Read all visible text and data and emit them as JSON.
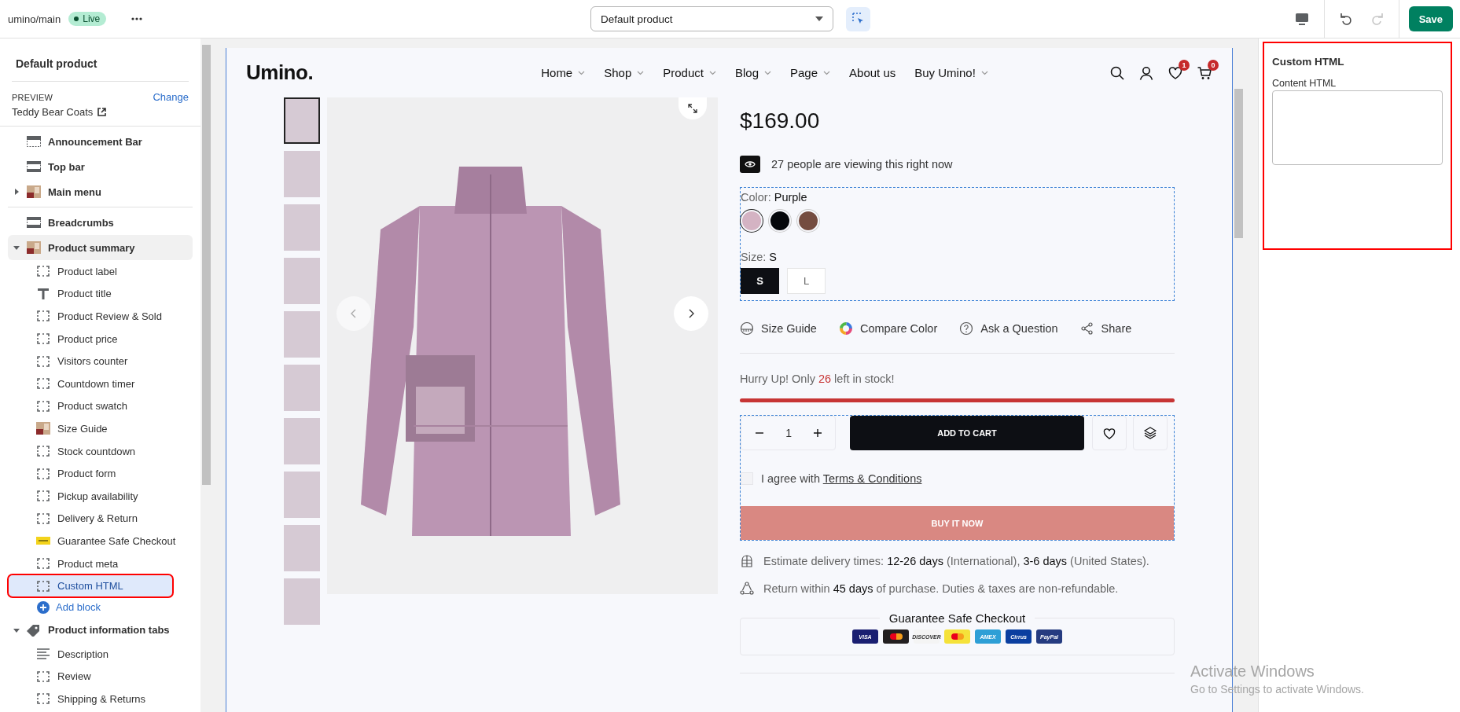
{
  "topbar": {
    "theme": "umino/main",
    "status": {
      "label": "Live"
    },
    "template_select": {
      "value": "Default product"
    },
    "inspector": {
      "selected": true
    },
    "undo": {
      "disabled": false
    },
    "redo": {
      "disabled": true
    },
    "save": "Save"
  },
  "sidebar": {
    "title": "Default product",
    "preview": {
      "label": "PREVIEW",
      "action": "Change",
      "value": "Teddy Bear Coats"
    },
    "groups": [
      {
        "items": [
          {
            "label": "Announcement Bar",
            "kind": "header-section",
            "selected": false
          },
          {
            "label": "Top bar",
            "kind": "section",
            "selected": false
          },
          {
            "label": "Main menu",
            "kind": "image",
            "selected": false,
            "expanded": false
          }
        ]
      },
      {
        "items": [
          {
            "label": "Breadcrumbs",
            "kind": "section",
            "selected": false
          },
          {
            "label": "Product summary",
            "kind": "image",
            "selected": false,
            "hovered": true,
            "expanded": true,
            "add_label": "Add block",
            "children": [
              {
                "label": "Product label",
                "kind": "block",
                "selected": false
              },
              {
                "label": "Product title",
                "kind": "text",
                "selected": false
              },
              {
                "label": "Product Review & Sold",
                "kind": "block",
                "selected": false
              },
              {
                "label": "Product price",
                "kind": "block",
                "selected": false
              },
              {
                "label": "Visitors counter",
                "kind": "block",
                "selected": false
              },
              {
                "label": "Countdown timer",
                "kind": "block",
                "selected": false
              },
              {
                "label": "Product swatch",
                "kind": "block",
                "selected": false
              },
              {
                "label": "Size Guide",
                "kind": "image",
                "selected": false
              },
              {
                "label": "Stock countdown",
                "kind": "block",
                "selected": false
              },
              {
                "label": "Product form",
                "kind": "block",
                "selected": false
              },
              {
                "label": "Pickup availability",
                "kind": "block",
                "selected": false
              },
              {
                "label": "Delivery & Return",
                "kind": "block",
                "selected": false
              },
              {
                "label": "Guarantee Safe Checkout",
                "kind": "banner",
                "selected": false
              },
              {
                "label": "Product meta",
                "kind": "block",
                "selected": false
              },
              {
                "label": "Custom HTML",
                "kind": "block",
                "selected": true,
                "highlighted": true
              }
            ]
          },
          {
            "label": "Product information tabs",
            "kind": "tag",
            "selected": false,
            "expanded": true,
            "children": [
              {
                "label": "Description",
                "kind": "lines",
                "selected": false
              },
              {
                "label": "Review",
                "kind": "block",
                "selected": false
              },
              {
                "label": "Shipping & Returns",
                "kind": "block",
                "selected": false
              }
            ]
          }
        ]
      }
    ]
  },
  "preview": {
    "header": {
      "logo": "Umino.",
      "nav": [
        {
          "label": "Home",
          "dropdown": true
        },
        {
          "label": "Shop",
          "dropdown": true
        },
        {
          "label": "Product",
          "dropdown": true
        },
        {
          "label": "Blog",
          "dropdown": true
        },
        {
          "label": "Page",
          "dropdown": true
        },
        {
          "label": "About us",
          "dropdown": false
        },
        {
          "label": "Buy Umino!",
          "dropdown": true
        }
      ],
      "wishlist_count": "1",
      "cart_count": "0"
    },
    "product": {
      "thumbnails": [
        {
          "selected": true
        },
        {
          "selected": false
        },
        {
          "selected": false
        },
        {
          "selected": false
        },
        {
          "selected": false
        },
        {
          "selected": false
        },
        {
          "selected": false
        },
        {
          "selected": false
        },
        {
          "selected": false
        },
        {
          "selected": false
        }
      ],
      "price": "$169.00",
      "viewers": "27 people are viewing this right now",
      "color": {
        "label": "Color:",
        "value": "Purple",
        "swatches": [
          {
            "color": "#d4b3c3",
            "selected": true
          },
          {
            "color": "#05070b",
            "selected": false
          },
          {
            "color": "#744c40",
            "selected": false
          }
        ]
      },
      "size": {
        "label": "Size:",
        "value": "S",
        "options": [
          {
            "label": "S",
            "selected": true
          },
          {
            "label": "L",
            "selected": false
          }
        ]
      },
      "actions": [
        {
          "kind": "ruler",
          "label": "Size Guide"
        },
        {
          "kind": "color-wheel",
          "label": "Compare Color"
        },
        {
          "kind": "question",
          "label": "Ask a Question"
        },
        {
          "kind": "share",
          "label": "Share"
        }
      ],
      "stock": {
        "prefix": "Hurry Up! Only",
        "count": "26",
        "suffix": "left in stock!",
        "level": 1
      },
      "quantity": "1",
      "add_to_cart": "ADD TO CART",
      "agree": {
        "text": "I agree with",
        "link": "Terms & Conditions",
        "checked": false
      },
      "buy_now": {
        "label": "BUY IT NOW",
        "disabled": true
      },
      "info": [
        {
          "kind": "delivery",
          "text": "Estimate delivery times: **12-26 days** (International), **3-6 days** (United States)."
        },
        {
          "kind": "return",
          "text": "Return within **45 days** of purchase. Duties & taxes are non-refundable."
        }
      ],
      "guarantee": {
        "title": "Guarantee Safe Checkout",
        "payments": [
          {
            "label": "VISA",
            "color": "#1a1f71"
          },
          {
            "color": "#231f20"
          },
          {
            "label": "DISCOVER",
            "color": "#f4f4f4"
          },
          {
            "color": "#f5e23a"
          },
          {
            "label": "AMEX",
            "color": "#2e9fd6"
          },
          {
            "label": "Cirrus",
            "color": "#0b3fa0"
          },
          {
            "label": "PayPal",
            "color": "#253b80"
          }
        ]
      }
    }
  },
  "panel": {
    "title": "Custom HTML",
    "field": {
      "label": "Content HTML"
    },
    "highlighted": true
  },
  "notice": {
    "title": "Activate Windows",
    "text": "Go to Settings to activate Windows."
  }
}
